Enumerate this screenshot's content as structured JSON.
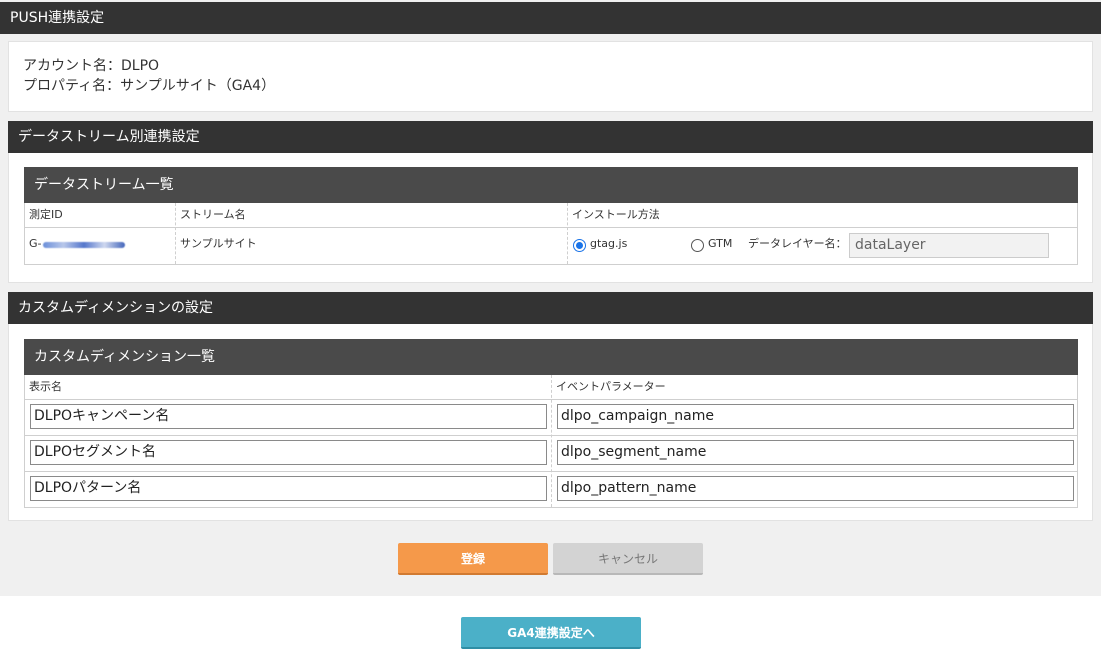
{
  "page": {
    "title": "PUSH連携設定"
  },
  "account_info": {
    "account_line": "アカウント名：DLPO",
    "property_line": "プロパティ名：サンプルサイト（GA4）"
  },
  "datastream_section": {
    "title": "データストリーム別連携設定",
    "list_title": "データストリーム一覧",
    "headers": {
      "measurement_id": "測定ID",
      "stream_name": "ストリーム名",
      "install_method": "インストール方法"
    },
    "row": {
      "measurement_id_prefix": "G-",
      "stream_name": "サンプルサイト",
      "option_gtag": "gtag.js",
      "option_gtm": "GTM",
      "datalayer_label": "データレイヤー名：",
      "datalayer_value": "dataLayer"
    }
  },
  "custom_dimension_section": {
    "title": "カスタムディメンションの設定",
    "list_title": "カスタムディメンション一覧",
    "headers": {
      "display_name": "表示名",
      "event_parameter": "イベントパラメーター"
    },
    "rows": [
      {
        "display_name": "DLPOキャンペーン名",
        "event_parameter": "dlpo_campaign_name"
      },
      {
        "display_name": "DLPOセグメント名",
        "event_parameter": "dlpo_segment_name"
      },
      {
        "display_name": "DLPOパターン名",
        "event_parameter": "dlpo_pattern_name"
      }
    ]
  },
  "buttons": {
    "register": "登録",
    "cancel": "キャンセル",
    "ga4_settings": "GA4連携設定へ"
  },
  "colors": {
    "header_bar": "#333333",
    "sub_header_bar": "#4a4a4a",
    "primary_button": "#f5994a",
    "secondary_button": "#d3d3d3",
    "link_button": "#4bb0c8",
    "radio_selected": "#1a73e8"
  }
}
